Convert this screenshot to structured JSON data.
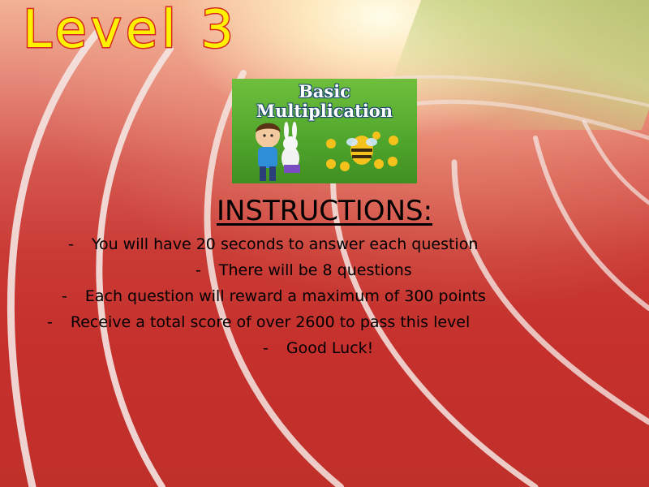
{
  "title": "Level 3",
  "logo": {
    "line1": "Basic",
    "line2": "Multiplication"
  },
  "heading": "INSTRUCTIONS:",
  "rules": [
    "You will have 20 seconds to answer each question",
    "There will be 8 questions",
    "Each question will reward a maximum of 300 points",
    "Receive a total score of over 2600 to pass this level",
    "Good Luck!"
  ],
  "bullet": "-",
  "colors": {
    "title_fill": "#fff200",
    "title_outline": "#d62b20",
    "track": "#c9372f",
    "lane_lines": "#f4e6e2"
  }
}
